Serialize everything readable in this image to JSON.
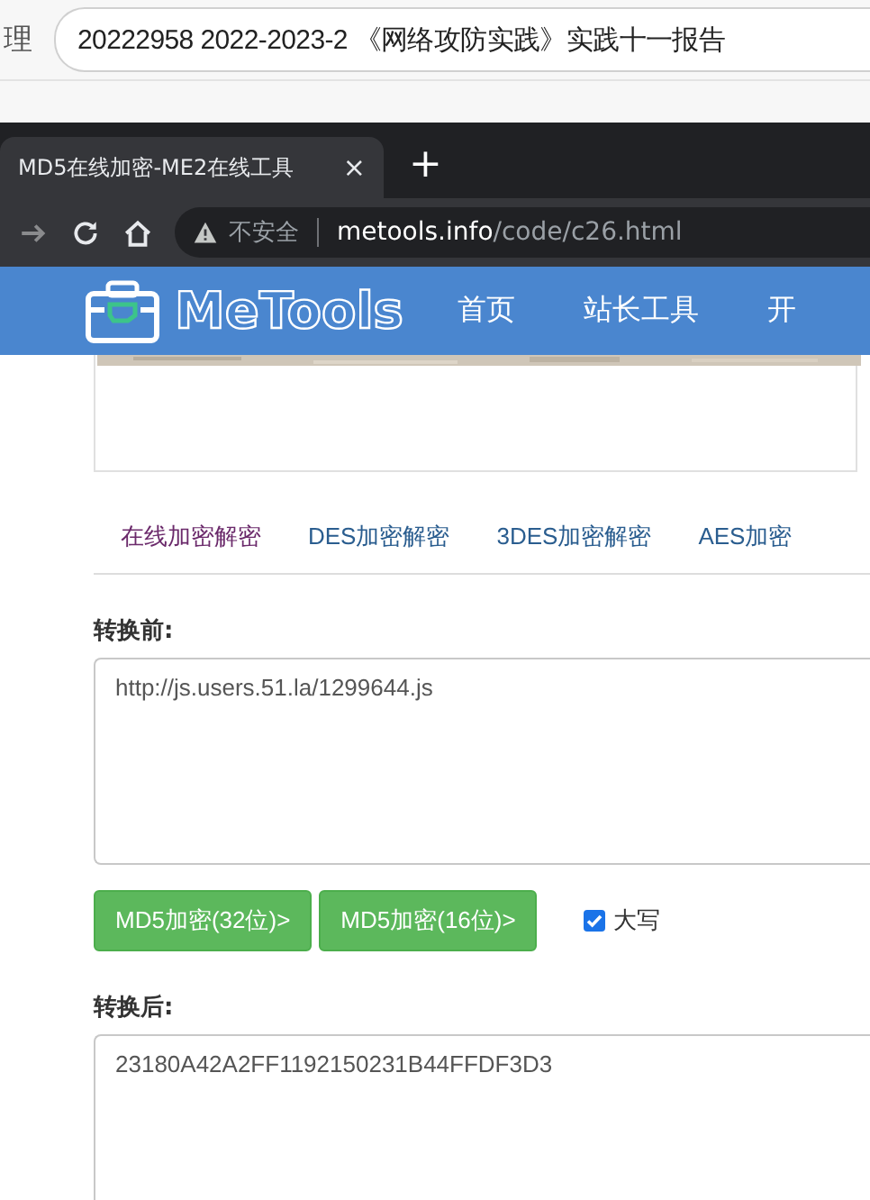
{
  "host_bar": {
    "cut_label": "理",
    "document_title": "20222958 2022-2023-2 《网络攻防实践》实践十一报告"
  },
  "browser": {
    "tab_title": "MD5在线加密-ME2在线工具",
    "tab_close": "×",
    "new_tab": "+",
    "security": "不安全",
    "url_host": "metools.info",
    "url_path": "/code/c26.html"
  },
  "site": {
    "logo": "MeTools",
    "nav": [
      "首页",
      "站长工具",
      "开"
    ]
  },
  "tabs": [
    {
      "label": "在线加密解密",
      "selected": true
    },
    {
      "label": "DES加密解密",
      "selected": false
    },
    {
      "label": "3DES加密解密",
      "selected": false
    },
    {
      "label": "AES加密",
      "selected": false
    }
  ],
  "input": {
    "label": "转换前:",
    "value": "http://js.users.51.la/1299644.js"
  },
  "buttons": [
    "MD5加密(32位)>",
    "MD5加密(16位)>"
  ],
  "uppercase": {
    "label": "大写",
    "checked": true
  },
  "output": {
    "label": "转换后:",
    "value": "23180A42A2FF1192150231B44FFDF3D3"
  }
}
